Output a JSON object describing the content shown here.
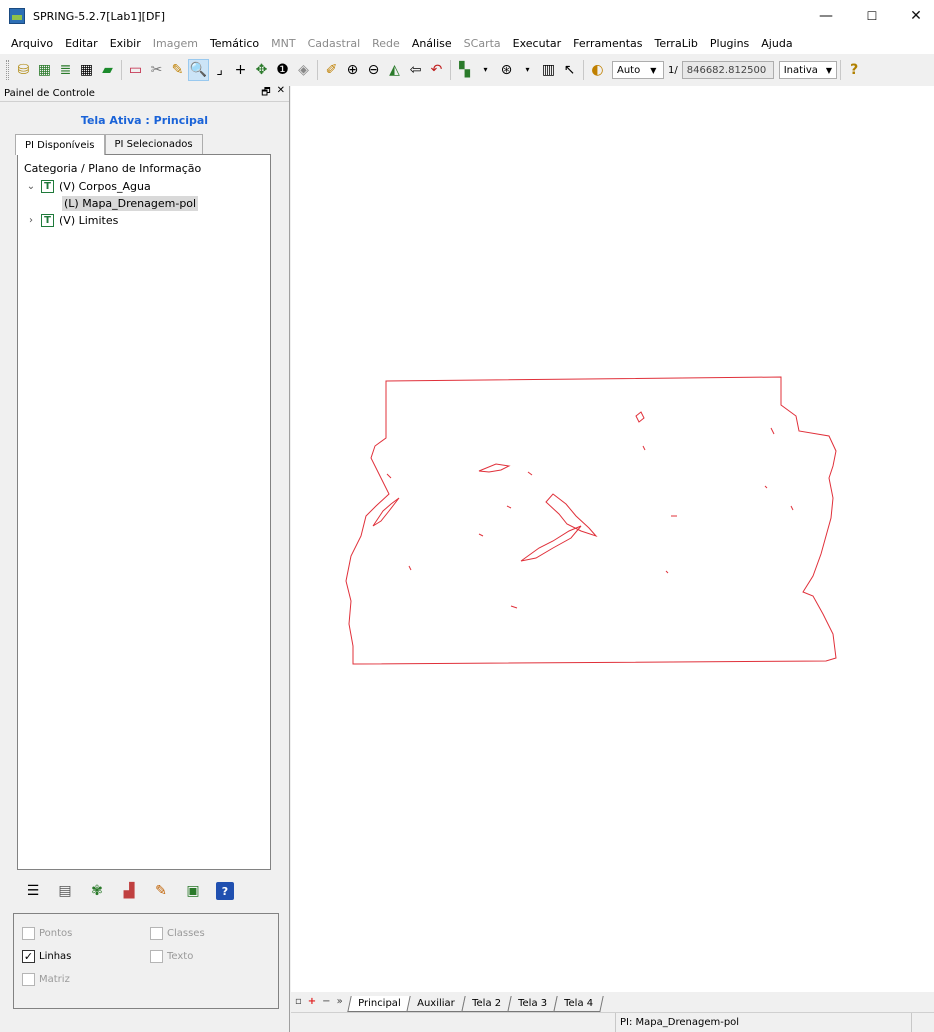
{
  "window": {
    "title": "SPRING-5.2.7[Lab1][DF]",
    "minimize": "—",
    "maximize": "☐",
    "close": "✕"
  },
  "menu": [
    {
      "label": "Arquivo",
      "enabled": true
    },
    {
      "label": "Editar",
      "enabled": true
    },
    {
      "label": "Exibir",
      "enabled": true
    },
    {
      "label": "Imagem",
      "enabled": false
    },
    {
      "label": "Temático",
      "enabled": true
    },
    {
      "label": "MNT",
      "enabled": false
    },
    {
      "label": "Cadastral",
      "enabled": false
    },
    {
      "label": "Rede",
      "enabled": false
    },
    {
      "label": "Análise",
      "enabled": true
    },
    {
      "label": "SCarta",
      "enabled": false
    },
    {
      "label": "Executar",
      "enabled": true
    },
    {
      "label": "Ferramentas",
      "enabled": true
    },
    {
      "label": "TerraLib",
      "enabled": true
    },
    {
      "label": "Plugins",
      "enabled": true
    },
    {
      "label": "Ajuda",
      "enabled": true
    }
  ],
  "toolbar": {
    "scale_mode": "Auto",
    "scale_prefix": "1/",
    "scale_value": "846682.812500",
    "status_combo": "Inativa",
    "help_glyph": "?"
  },
  "panel": {
    "title": "Painel de Controle",
    "pin": "🗗",
    "close": "✕",
    "active_screen": "Tela Ativa : Principal",
    "tabs": [
      "PI Disponíveis",
      "PI Selecionados"
    ],
    "tree_header": "Categoria / Plano de Informação",
    "tree": [
      {
        "label": "(V) Corpos_Agua",
        "expanded": true,
        "twist": "⌄",
        "type": "T",
        "children": [
          "(L) Mapa_Drenagem-pol"
        ]
      },
      {
        "label": "(V) Limites",
        "expanded": false,
        "twist": "›",
        "type": "T",
        "children": []
      }
    ],
    "visibility": {
      "pontos": {
        "label": "Pontos",
        "checked": false,
        "enabled": false
      },
      "classes": {
        "label": "Classes",
        "checked": false,
        "enabled": false
      },
      "linhas": {
        "label": "Linhas",
        "checked": true,
        "enabled": true
      },
      "texto": {
        "label": "Texto",
        "checked": false,
        "enabled": false
      },
      "matriz": {
        "label": "Matriz",
        "checked": false,
        "enabled": false
      }
    }
  },
  "map": {
    "line_color": "#e0303a",
    "background": "#ffffff"
  },
  "bottom_tabs": [
    "Principal",
    "Auxiliar",
    "Tela 2",
    "Tela 3",
    "Tela 4"
  ],
  "active_bottom_tab": "Principal",
  "status": {
    "pi": "PI: Mapa_Drenagem-pol"
  },
  "colors": {
    "accent_blue": "#1a63d8",
    "tree_icon_green": "#1f7a3b"
  }
}
